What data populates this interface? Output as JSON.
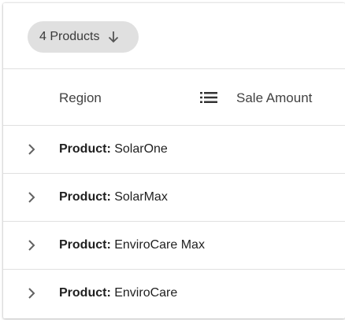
{
  "toolbar": {
    "group_chip_label": "4 Products",
    "group_chip_icon": "arrow-down-icon"
  },
  "header": {
    "region_label": "Region",
    "menu_icon": "list-menu-icon",
    "amount_label": "Sale Amount"
  },
  "rows": [
    {
      "prefix": "Product:",
      "value": "SolarOne",
      "icon": "chevron-right-icon"
    },
    {
      "prefix": "Product:",
      "value": "SolarMax",
      "icon": "chevron-right-icon"
    },
    {
      "prefix": "Product:",
      "value": "EnviroCare Max",
      "icon": "chevron-right-icon"
    },
    {
      "prefix": "Product:",
      "value": "EnviroCare",
      "icon": "chevron-right-icon"
    }
  ],
  "colors": {
    "chip_background": "#e0e0e0",
    "divider": "#e0e0e0",
    "icon": "#616161"
  }
}
